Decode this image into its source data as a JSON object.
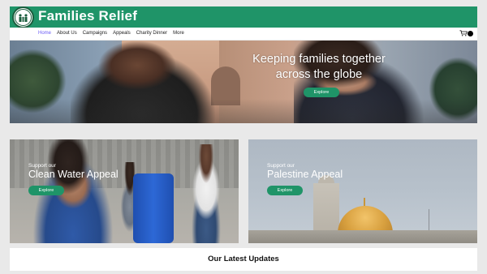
{
  "header": {
    "site_title": "Families Relief",
    "logo_icon": "families-relief-logo-icon",
    "brand_color": "#1f9468"
  },
  "nav": {
    "items": [
      "Home",
      "About Us",
      "Campaigns",
      "Appeals",
      "Charity Dinner",
      "More"
    ],
    "active": "Home",
    "active_color": "#6b5cf6",
    "cart_icon": "shopping-cart-icon"
  },
  "hero": {
    "title": "Keeping families together across the globe",
    "button_label": "Explore"
  },
  "appeals": [
    {
      "eyebrow": "Support our",
      "title": "Clean Water Appeal",
      "button_label": "Explore"
    },
    {
      "eyebrow": "Support our",
      "title": "Palestine Appeal",
      "button_label": "Explore"
    }
  ],
  "updates": {
    "title": "Our Latest Updates"
  }
}
